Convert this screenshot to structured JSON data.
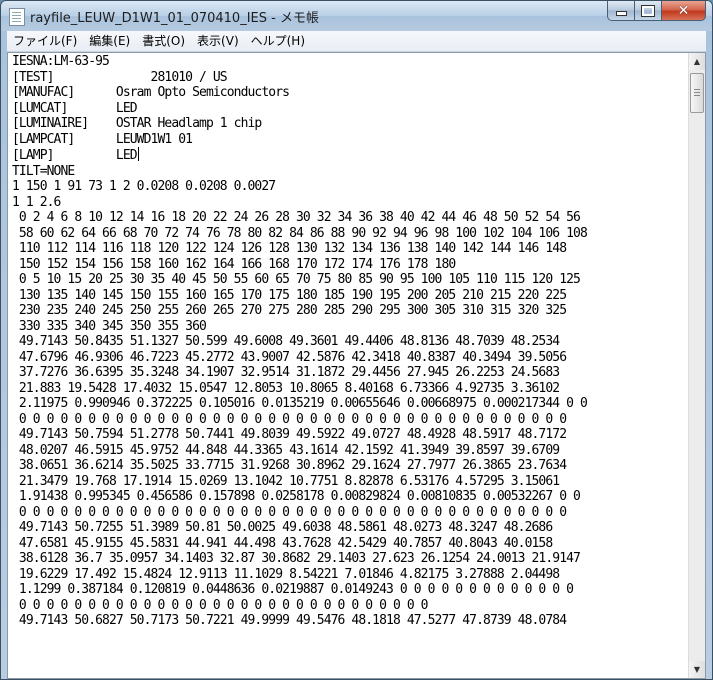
{
  "window": {
    "title": "rayfile_LEUW_D1W1_01_070410_IES - メモ帳",
    "minimize_glyph": "",
    "close_glyph": "✕"
  },
  "menu": {
    "items": [
      {
        "label": "ファイル(F)"
      },
      {
        "label": "編集(E)"
      },
      {
        "label": "書式(O)"
      },
      {
        "label": "表示(V)"
      },
      {
        "label": "ヘルプ(H)"
      }
    ]
  },
  "icons": {
    "app": "notepad-icon",
    "minimize": "minimize-icon",
    "maximize": "maximize-icon",
    "close": "close-icon",
    "scroll_up": "chevron-up-icon",
    "scroll_down": "chevron-down-icon"
  },
  "scrollbar": {
    "up_glyph": "▲",
    "down_glyph": "▼"
  },
  "document": {
    "lines": [
      "IESNA:LM-63-95",
      "[TEST]              281010 / US",
      "[MANUFAC]      Osram Opto Semiconductors",
      "[LUMCAT]       LED",
      "[LUMINAIRE]    OSTAR Headlamp 1 chip",
      "[LAMPCAT]      LEUWD1W1 01",
      "[LAMP]         LED",
      "TILT=NONE",
      "1 150 1 91 73 1 2 0.0208 0.0208 0.0027",
      "1 1 2.6",
      " 0 2 4 6 8 10 12 14 16 18 20 22 24 26 28 30 32 34 36 38 40 42 44 46 48 50 52 54 56",
      " 58 60 62 64 66 68 70 72 74 76 78 80 82 84 86 88 90 92 94 96 98 100 102 104 106 108",
      " 110 112 114 116 118 120 122 124 126 128 130 132 134 136 138 140 142 144 146 148",
      " 150 152 154 156 158 160 162 164 166 168 170 172 174 176 178 180",
      " 0 5 10 15 20 25 30 35 40 45 50 55 60 65 70 75 80 85 90 95 100 105 110 115 120 125",
      " 130 135 140 145 150 155 160 165 170 175 180 185 190 195 200 205 210 215 220 225",
      " 230 235 240 245 250 255 260 265 270 275 280 285 290 295 300 305 310 315 320 325",
      " 330 335 340 345 350 355 360",
      " 49.7143 50.8435 51.1327 50.599 49.6008 49.3601 49.4406 48.8136 48.7039 48.2534",
      " 47.6796 46.9306 46.7223 45.2772 43.9007 42.5876 42.3418 40.8387 40.3494 39.5056",
      " 37.7276 36.6395 35.3248 34.1907 32.9514 31.1872 29.4456 27.945 26.2253 24.5683",
      " 21.883 19.5428 17.4032 15.0547 12.8053 10.8065 8.40168 6.73366 4.92735 3.36102",
      " 2.11975 0.990946 0.372225 0.105016 0.0135219 0.00655646 0.00668975 0.000217344 0 0",
      " 0 0 0 0 0 0 0 0 0 0 0 0 0 0 0 0 0 0 0 0 0 0 0 0 0 0 0 0 0 0 0 0 0 0 0 0 0 0 0 0",
      " 49.7143 50.7594 51.2778 50.7441 49.8039 49.5922 49.0727 48.4928 48.5917 48.7172",
      " 48.0207 46.5915 45.9752 44.848 44.3365 43.1614 42.1592 41.3949 39.8597 39.6709",
      " 38.0651 36.6214 35.5025 33.7715 31.9268 30.8962 29.1624 27.7977 26.3865 23.7634",
      " 21.3479 19.768 17.1914 15.0269 13.1042 10.7751 8.82878 6.53176 4.57295 3.15061",
      " 1.91438 0.995345 0.456586 0.157898 0.0258178 0.00829824 0.00810835 0.00532267 0 0",
      " 0 0 0 0 0 0 0 0 0 0 0 0 0 0 0 0 0 0 0 0 0 0 0 0 0 0 0 0 0 0 0 0 0 0 0 0 0 0 0 0",
      " 49.7143 50.7255 51.3989 50.81 50.0025 49.6038 48.5861 48.0273 48.3247 48.2686",
      " 47.6581 45.9155 45.5831 44.941 44.498 43.7628 42.5429 40.7857 40.8043 40.0158",
      " 38.6128 36.7 35.0957 34.1403 32.87 30.8682 29.1403 27.623 26.1254 24.0013 21.9147",
      " 19.6229 17.492 15.4824 12.9113 11.1029 8.54221 7.01846 4.82175 3.27888 2.04498",
      " 1.1299 0.387184 0.120819 0.0448636 0.0219887 0.0149243 0 0 0 0 0 0 0 0 0 0 0 0 0",
      " 0 0 0 0 0 0 0 0 0 0 0 0 0 0 0 0 0 0 0 0 0 0 0 0 0 0 0 0 0 0",
      " 49.7143 50.6827 50.7173 50.7221 49.9999 49.5476 48.1818 47.5277 47.8739 48.0784"
    ]
  }
}
